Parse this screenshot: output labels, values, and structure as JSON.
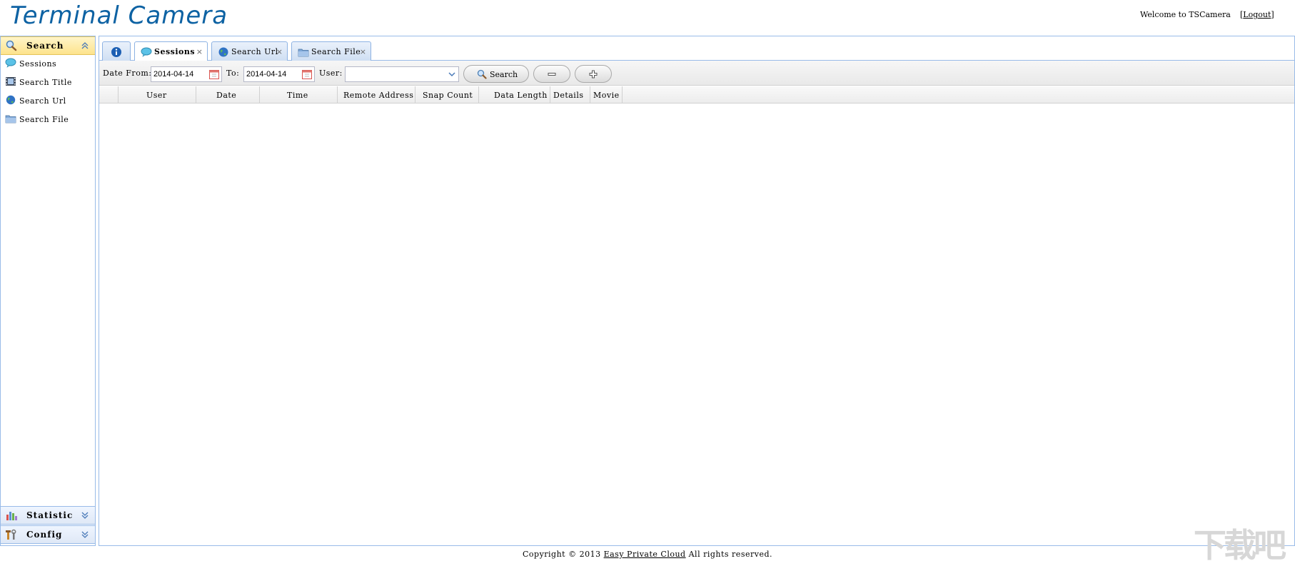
{
  "header": {
    "logo_text": "Terminal Camera",
    "welcome_text": "Welcome to TSCamera",
    "logout_open": "[",
    "logout_label": "Logout",
    "logout_close": "]"
  },
  "sidebar": {
    "search_section": {
      "title": "Search",
      "items": [
        {
          "label": "Sessions",
          "icon": "speech-bubble-icon"
        },
        {
          "label": "Search Title",
          "icon": "film-icon"
        },
        {
          "label": "Search Url",
          "icon": "globe-icon"
        },
        {
          "label": "Search File",
          "icon": "folder-icon"
        }
      ]
    },
    "statistic_section": {
      "title": "Statistic"
    },
    "config_section": {
      "title": "Config"
    }
  },
  "tabs": [
    {
      "label": "",
      "icon": "info-icon",
      "closable": false
    },
    {
      "label": "Sessions",
      "icon": "speech-bubble-icon",
      "closable": true,
      "active": true
    },
    {
      "label": "Search Url",
      "icon": "globe-icon",
      "closable": true
    },
    {
      "label": "Search File",
      "icon": "folder-icon",
      "closable": true
    }
  ],
  "toolbar": {
    "date_from_label": "Date From:",
    "date_from_value": "2014-04-14",
    "to_label": "To:",
    "to_value": "2014-04-14",
    "user_label": "User:",
    "user_value": "",
    "search_label": "Search"
  },
  "grid": {
    "columns": [
      "User",
      "Date",
      "Time",
      "Remote Address",
      "Snap Count",
      "Data Length",
      "Details",
      "Movie"
    ],
    "rows": []
  },
  "footer": {
    "copyright_prefix": "Copyright © 2013",
    "link_label": "Easy Private Cloud",
    "copyright_suffix": "All rights reserved."
  },
  "colors": {
    "brand": "#0d62a3",
    "border": "#99bbe8",
    "active_accordion": "#fde38c"
  }
}
